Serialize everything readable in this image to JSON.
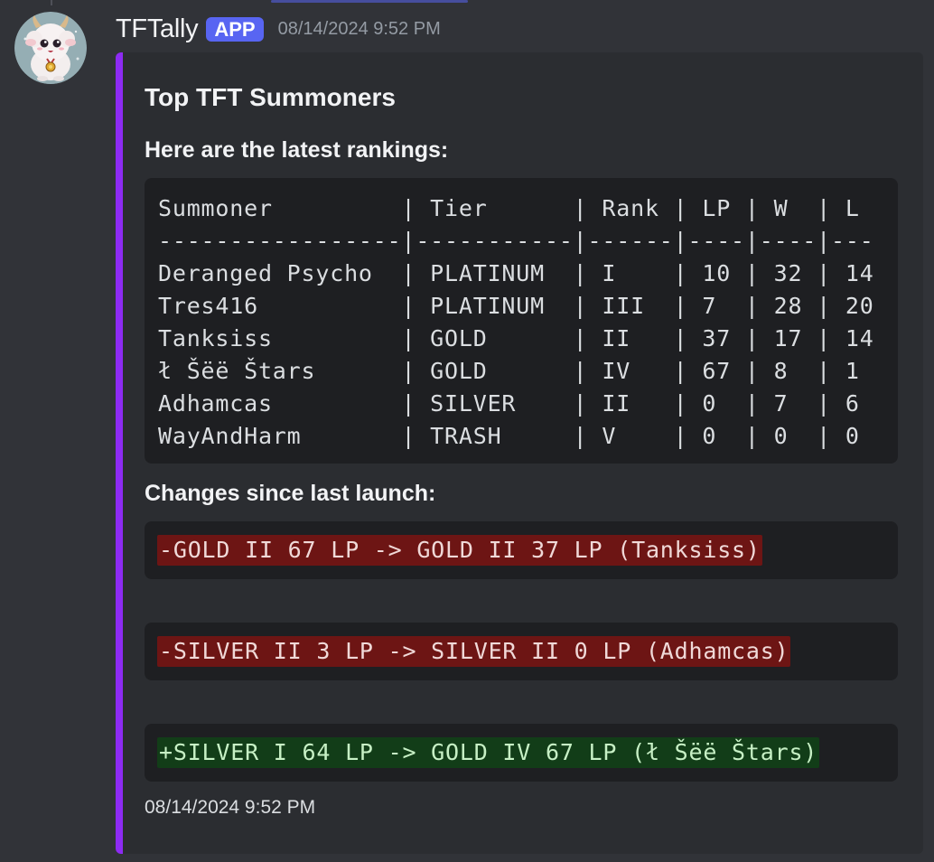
{
  "message": {
    "username": "TFTally",
    "badge": "APP",
    "timestamp": "08/14/2024 9:52 PM",
    "avatar_icon": "fluffy-creature-avatar-icon"
  },
  "embed": {
    "accent_color": "#8d2bf3",
    "title": "Top TFT Summoners",
    "subtitle": "Here are the latest rankings:",
    "rankings_table": {
      "lines": [
        "Summoner         | Tier      | Rank | LP | W  | L",
        "-----------------|-----------|------|----|----|---",
        "Deranged Psycho  | PLATINUM  | I    | 10 | 32 | 14",
        "Tres416          | PLATINUM  | III  | 7  | 28 | 20",
        "Tanksiss         | GOLD      | II   | 37 | 17 | 14",
        "ł Šëë Štars      | GOLD      | IV   | 67 | 8  | 1",
        "Adhamcas         | SILVER    | II   | 0  | 7  | 6",
        "WayAndHarm       | TRASH     | V    | 0  | 0  | 0"
      ]
    },
    "changes_heading": "Changes since last launch:",
    "changes": [
      {
        "type": "remove",
        "text": "-GOLD II 67 LP -> GOLD II 37 LP (Tanksiss)"
      },
      {
        "type": "remove",
        "text": "-SILVER II 3 LP -> SILVER II 0 LP (Adhamcas)"
      },
      {
        "type": "add",
        "text": "+SILVER I 64 LP -> GOLD IV 67 LP (ł Šëë Štars)"
      }
    ],
    "footer_timestamp": "08/14/2024 9:52 PM"
  },
  "colors": {
    "background": "#313338",
    "embed_background": "#2b2d31",
    "code_background": "#1e1f22",
    "badge": "#5865f2",
    "diff_remove": "#6d1514",
    "diff_add": "#123d18"
  }
}
